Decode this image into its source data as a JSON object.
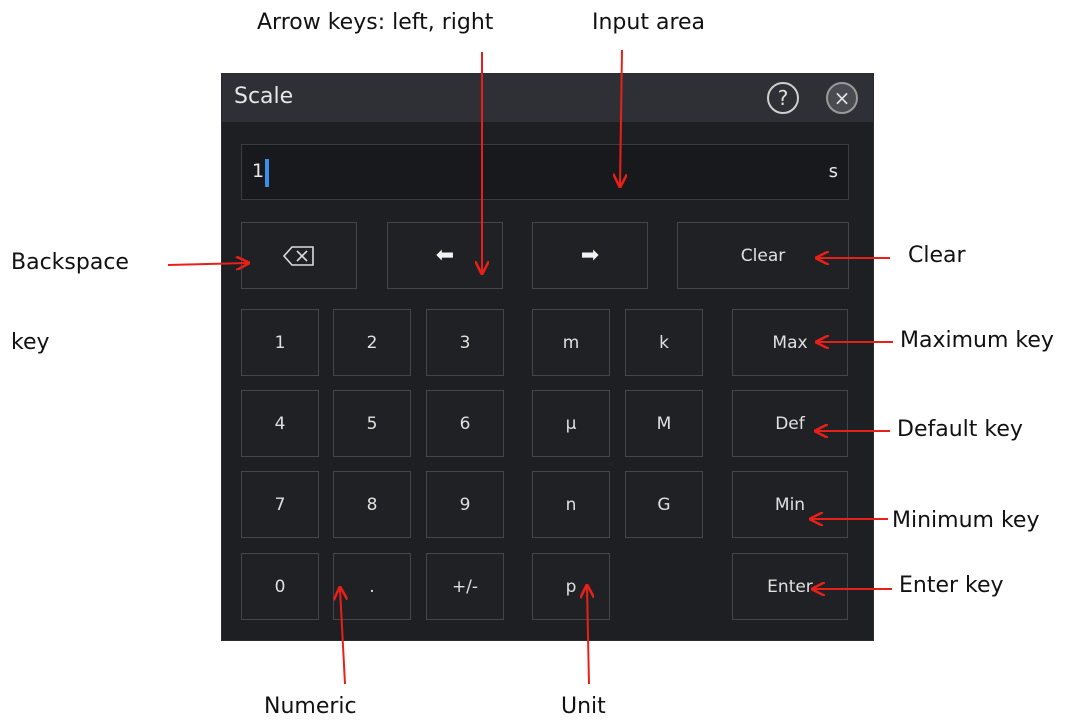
{
  "dialog": {
    "title": "Scale",
    "help_glyph": "?",
    "close_glyph": "×"
  },
  "input": {
    "value": "1",
    "unit": "s"
  },
  "edit_keys": {
    "backspace_icon": "backspace-icon",
    "left_arrow": "⬅",
    "right_arrow": "➡",
    "clear": "Clear"
  },
  "digits": {
    "d1": "1",
    "d2": "2",
    "d3": "3",
    "d4": "4",
    "d5": "5",
    "d6": "6",
    "d7": "7",
    "d8": "8",
    "d9": "9",
    "d0": "0",
    "dot": ".",
    "sign": "+/-"
  },
  "units": {
    "m": "m",
    "k": "k",
    "mu": "μ",
    "M": "M",
    "n": "n",
    "G": "G",
    "p": "p"
  },
  "functions": {
    "max": "Max",
    "def": "Def",
    "min": "Min",
    "enter": "Enter"
  },
  "annotations": {
    "arrow_keys": "Arrow keys: left, right",
    "input_area": "Input area",
    "backspace_line1": "Backspace",
    "backspace_line2": "key",
    "clear": "Clear",
    "maximum": "Maximum key",
    "default": "Default key",
    "minimum": "Minimum key",
    "enter": "Enter key",
    "numeric": "Numeric",
    "unit": "Unit"
  },
  "colors": {
    "annotation_arrow": "#e8201a",
    "cursor": "#3d8ee6",
    "dialog_bg": "#1e1f23",
    "titlebar_bg": "#2e3036"
  }
}
